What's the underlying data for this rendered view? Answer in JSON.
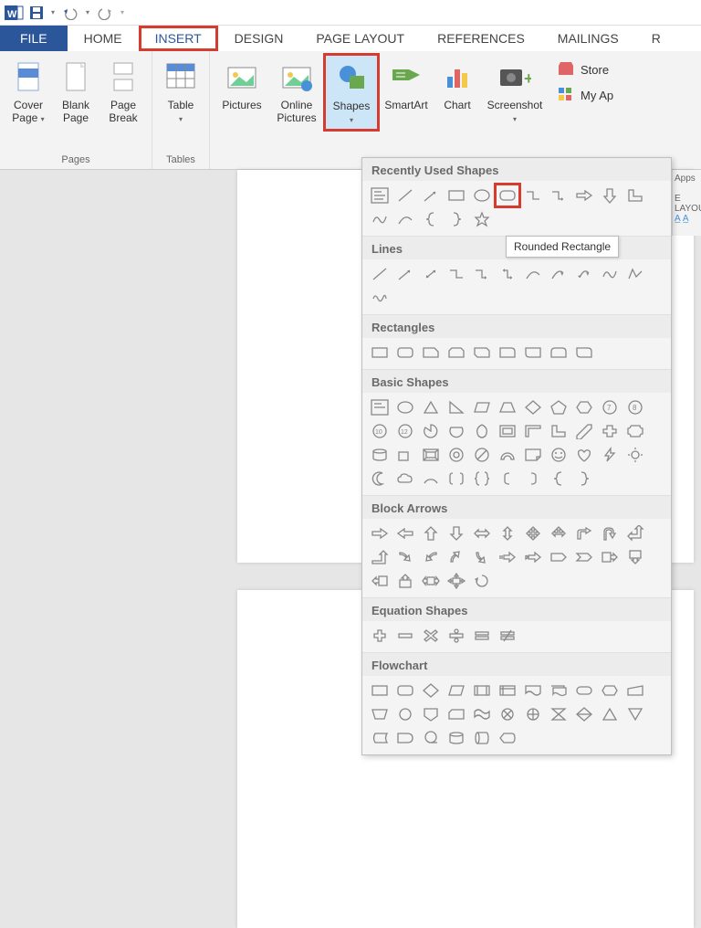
{
  "menu": {
    "file": "FILE",
    "home": "HOME",
    "insert": "INSERT",
    "design": "DESIGN",
    "page_layout": "PAGE LAYOUT",
    "references": "REFERENCES",
    "mailings": "MAILINGS",
    "r": "R"
  },
  "ribbon": {
    "pages": {
      "label": "Pages",
      "cover_page": "Cover Page",
      "blank_page": "Blank Page",
      "page_break": "Page Break"
    },
    "tables": {
      "label": "Tables",
      "table": "Table"
    },
    "illustrations": {
      "pictures": "Pictures",
      "online_pictures": "Online Pictures",
      "shapes": "Shapes",
      "smartart": "SmartArt",
      "chart": "Chart",
      "screenshot": "Screenshot"
    },
    "apps": {
      "store": "Store",
      "my_apps": "My Ap"
    }
  },
  "shapes_panel": {
    "cat_recent": "Recently Used Shapes",
    "cat_lines": "Lines",
    "cat_rectangles": "Rectangles",
    "cat_basic": "Basic Shapes",
    "cat_block": "Block Arrows",
    "cat_equation": "Equation Shapes",
    "cat_flowchart": "Flowchart"
  },
  "tooltip": "Rounded Rectangle",
  "right_frag": {
    "apps": "Apps",
    "layout": "E LAYOU"
  }
}
